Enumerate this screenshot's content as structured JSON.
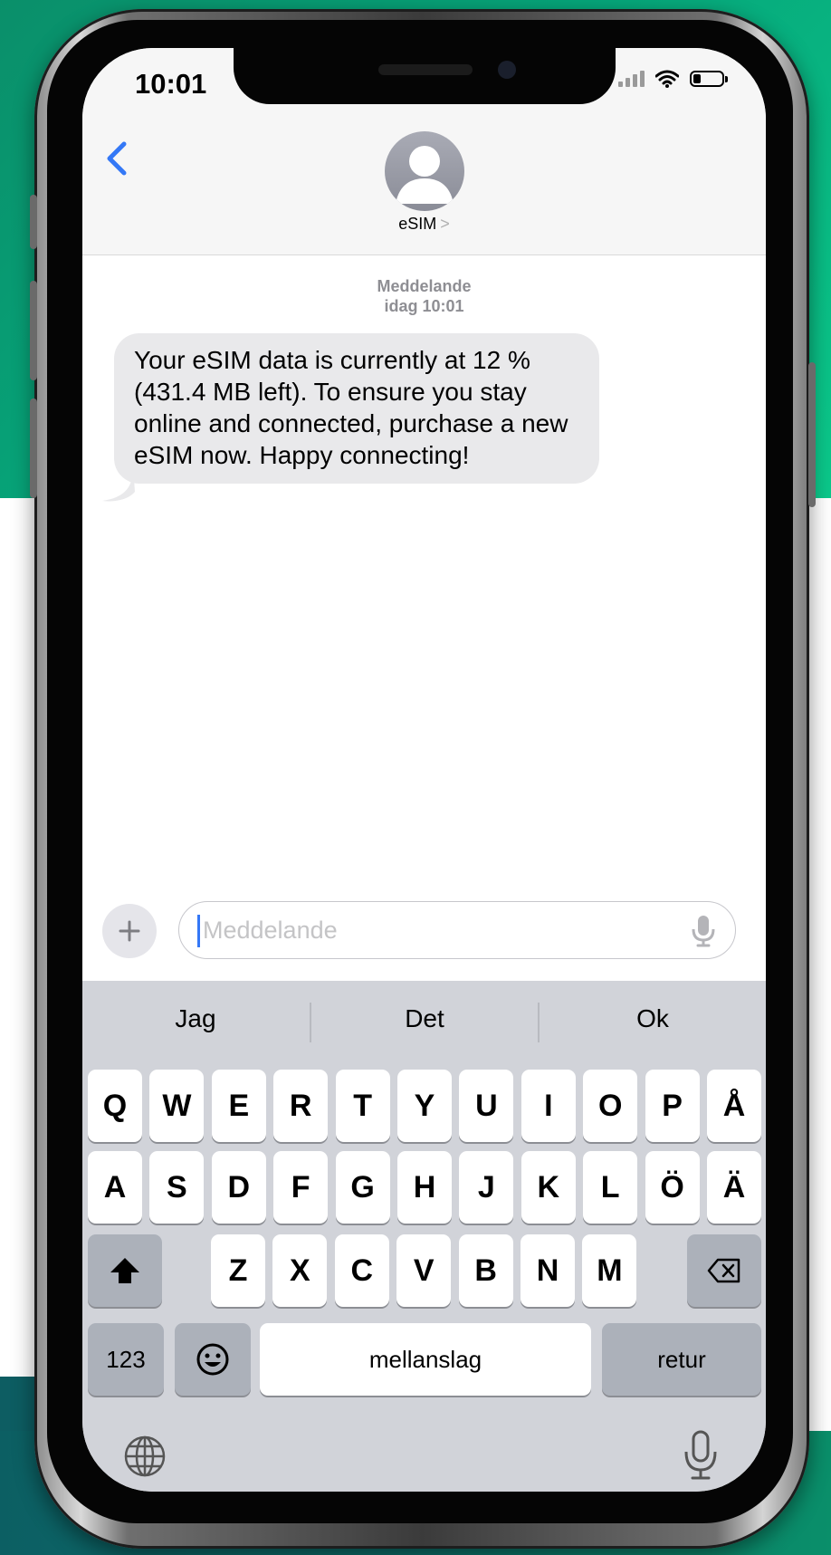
{
  "status_bar": {
    "time": "10:01",
    "battery_level": 0.25
  },
  "header": {
    "contact_name": "eSIM",
    "contact_chevron": ">"
  },
  "thread": {
    "label": "Meddelande",
    "timestamp": "idag 10:01",
    "messages": [
      {
        "text": "Your eSIM data is currently at 12 % (431.4 MB left). To ensure you stay online and connected, purchase a new eSIM now. Happy connecting!"
      }
    ]
  },
  "compose": {
    "placeholder": "Meddelande"
  },
  "keyboard": {
    "suggestions": [
      "Jag",
      "Det",
      "Ok"
    ],
    "row1": [
      "Q",
      "W",
      "E",
      "R",
      "T",
      "Y",
      "U",
      "I",
      "O",
      "P",
      "Å"
    ],
    "row2": [
      "A",
      "S",
      "D",
      "F",
      "G",
      "H",
      "J",
      "K",
      "L",
      "Ö",
      "Ä"
    ],
    "row3": [
      "Z",
      "X",
      "C",
      "V",
      "B",
      "N",
      "M"
    ],
    "numbers_label": "123",
    "space_label": "mellanslag",
    "return_label": "retur"
  },
  "icons": [
    "back-chevron-icon",
    "person-avatar-icon",
    "plus-icon",
    "mic-icon",
    "shift-icon",
    "delete-icon",
    "emoji-icon",
    "globe-icon",
    "dictation-mic-icon",
    "wifi-icon",
    "signal-icon",
    "battery-icon"
  ],
  "colors": {
    "accent": "#3478f6",
    "bubble": "#e9e9eb",
    "keyboard": "#d1d3d9",
    "background_green": "#06a67a"
  }
}
